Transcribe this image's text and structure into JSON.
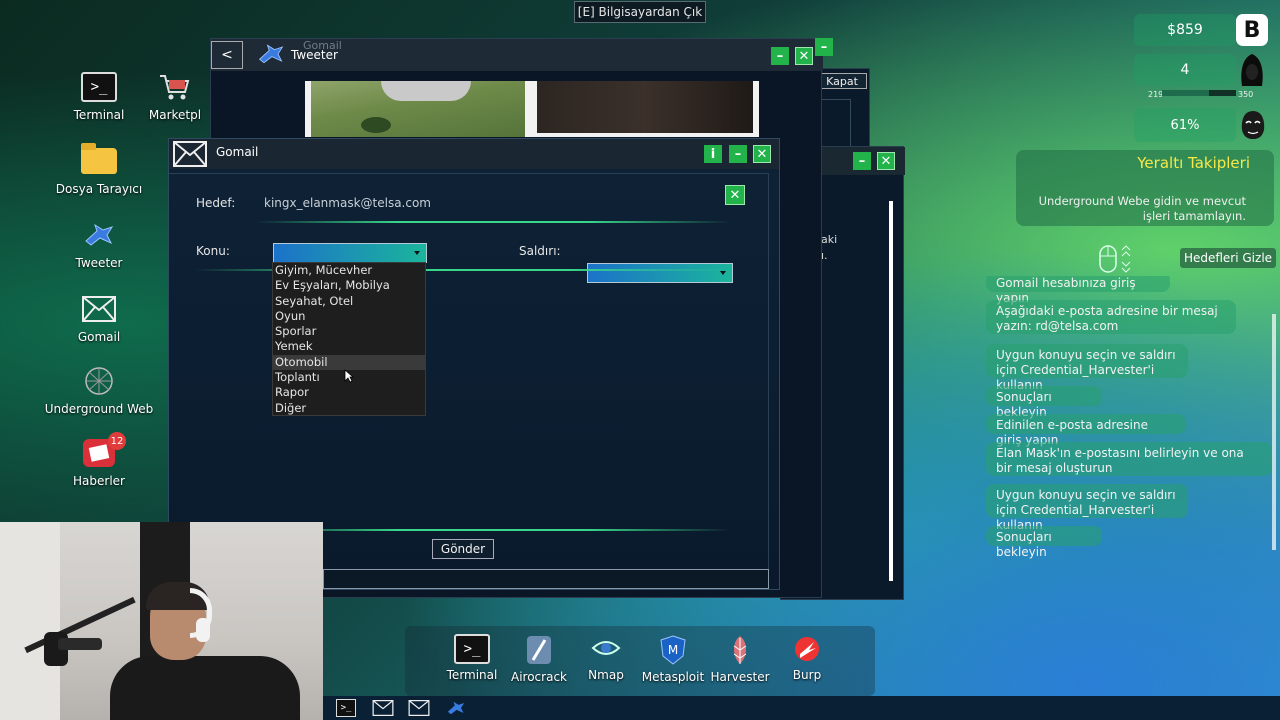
{
  "top": {
    "exit_label": "[E] Bilgisayardan Çık"
  },
  "desktop": {
    "icons": [
      {
        "label": "Terminal"
      },
      {
        "label": "Marketpl"
      },
      {
        "label": "Dosya Tarayıcı"
      },
      {
        "label": "Tweeter"
      },
      {
        "label": "Gomail"
      },
      {
        "label": "Underground Web"
      },
      {
        "label": "Haberler",
        "badge": "12"
      }
    ]
  },
  "windows": {
    "tweeter": {
      "back_label": "<",
      "title": "Tweeter",
      "behind_title": "Gomail"
    },
    "back_right": {
      "button_label": "Kapat",
      "text1": "aki",
      "text2": "ı."
    },
    "gomail": {
      "title": "Gomail",
      "hedef_label": "Hedef:",
      "hedef_value": "kingx_elanmask@telsa.com",
      "konu_label": "Konu:",
      "saldiri_label": "Saldırı:",
      "konu_options": [
        "Giyim, Mücevher",
        "Ev Eşyaları, Mobilya",
        "Seyahat, Otel",
        "Oyun",
        "Sporlar",
        "Yemek",
        "Otomobil",
        "Toplantı",
        "Rapor",
        "Diğer"
      ],
      "highlighted_option": "Otomobil",
      "send_label": "Gönder",
      "info_label": "i"
    }
  },
  "stats": {
    "money": "$859",
    "level": "4",
    "xp_current": "219",
    "xp_max": "350",
    "percent": "61%"
  },
  "objectives": {
    "title": "Yeraltı Takipleri",
    "description": "Underground Webe gidin ve mevcut işleri tamamlayın.",
    "hide_label": "Hedefleri Gizle",
    "tasks": [
      "Gomail hesabınıza giriş yapın",
      "Aşağıdaki e-posta adresine bir mesaj yazın: rd@telsa.com",
      "Uygun konuyu seçin ve saldırı için Credential_Harvester'i kullanın",
      "Sonuçları bekleyin",
      "Edinilen e-posta adresine giriş yapın",
      "Elan Mask'ın e-postasını belirleyin ve ona bir mesaj oluşturun",
      "Uygun konuyu seçin ve saldırı için Credential_Harvester'i kullanın",
      "Sonuçları bekleyin"
    ]
  },
  "dock": {
    "items": [
      {
        "label": "Terminal"
      },
      {
        "label": "Airocrack"
      },
      {
        "label": "Nmap"
      },
      {
        "label": "Metasploit"
      },
      {
        "label": "Harvester"
      },
      {
        "label": "Burp"
      }
    ]
  },
  "colors": {
    "accent_green": "#22b34b",
    "dropdown_start": "#1c72c9",
    "dropdown_end": "#1bb59c"
  }
}
